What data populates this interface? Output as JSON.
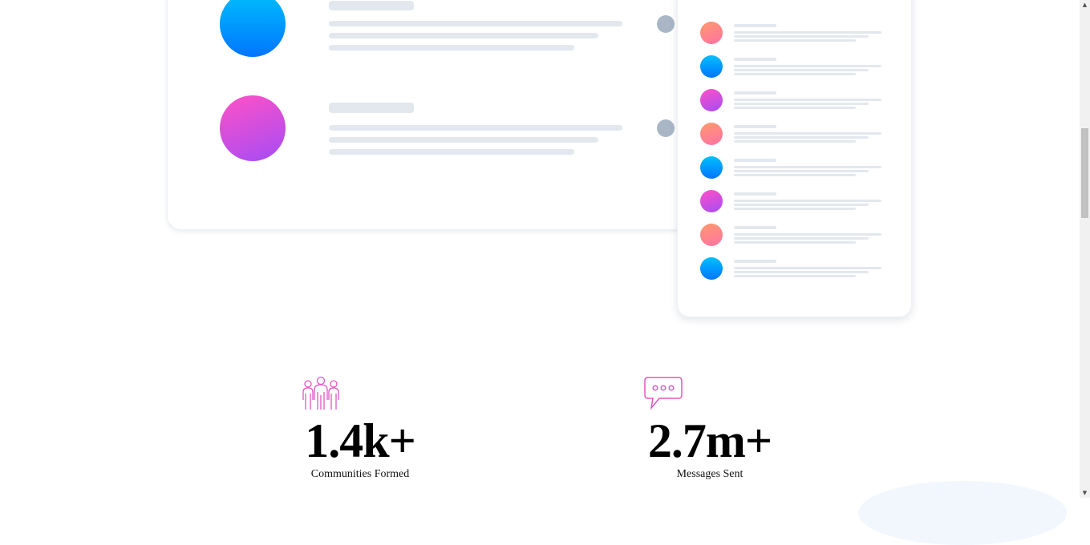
{
  "stats": [
    {
      "value": "1.4k+",
      "label": "Communities Formed",
      "icon": "communities-icon"
    },
    {
      "value": "2.7m+",
      "label": "Messages Sent",
      "icon": "messages-icon"
    }
  ],
  "colors": {
    "accent_pink": "#e056c5",
    "bar_grey": "#e3e8ef",
    "dot_grey": "#a9b6c6",
    "blue_gradient": [
      "#00c0fc",
      "#0075ff"
    ],
    "pink_gradient": [
      "#ff51c6",
      "#a54cf5"
    ],
    "peach_gradient": [
      "#ff9a6c",
      "#ff72a5"
    ]
  },
  "scrollbar": {
    "up_arrow": "▲",
    "down_arrow": "▼"
  }
}
